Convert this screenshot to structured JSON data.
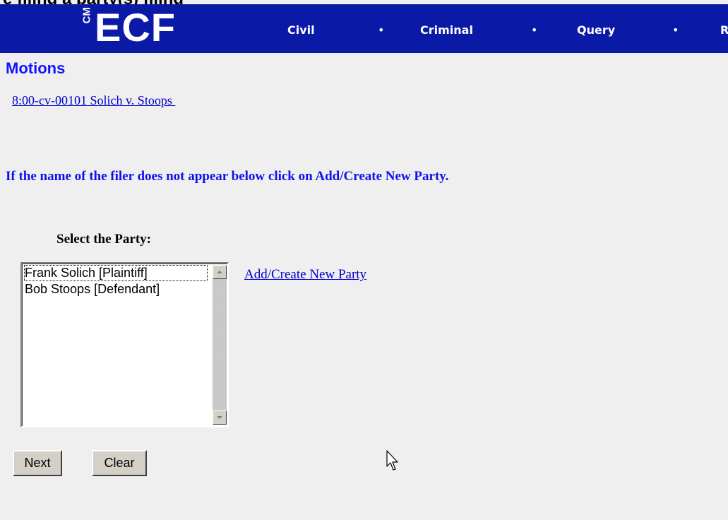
{
  "page_heading_partial": "e filing a party(s) filing",
  "header": {
    "logo_cm": "CM",
    "logo_ecf": "ECF",
    "nav": [
      {
        "label": "Civil"
      },
      {
        "label": "Criminal"
      },
      {
        "label": "Query"
      },
      {
        "label": "R"
      }
    ],
    "separator": "•",
    "background_color": "#0b1aa6"
  },
  "main": {
    "title": "Motions",
    "case_link": "8:00-cv-00101 Solich v. Stoops ",
    "instruction": "If the name of the filer does not appear below click on Add/Create New Party.",
    "select_label": "Select the Party:",
    "party_list": {
      "items": [
        {
          "label": "Frank Solich [Plaintiff]"
        },
        {
          "label": "Bob Stoops [Defendant]"
        }
      ]
    },
    "add_party_link": "Add/Create New Party",
    "buttons": {
      "next": "Next",
      "clear": "Clear"
    }
  },
  "colors": {
    "title": "#1414ff",
    "link": "#0000cc",
    "page_background": "#efefef"
  }
}
